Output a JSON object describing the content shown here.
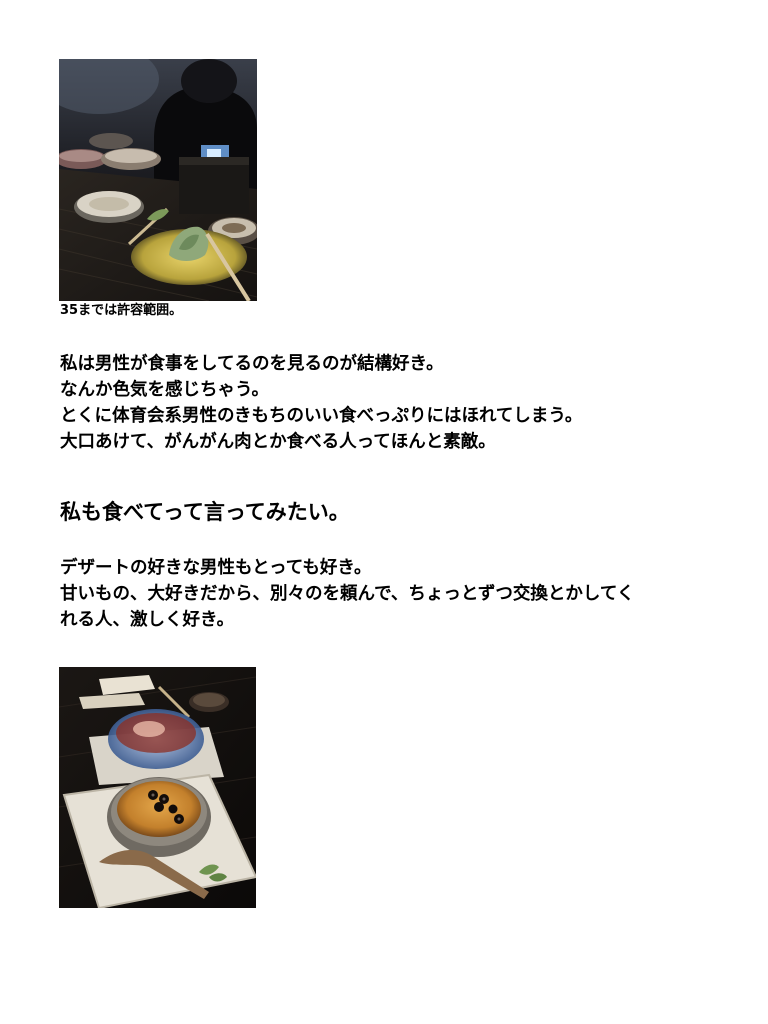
{
  "post": {
    "photo1": {
      "alt_icon": "food-photo-icon"
    },
    "caption": "35までは許容範囲。",
    "paragraph1": [
      "私は男性が食事をしてるのを見るのが結構好き。",
      "なんか色気を感じちゃう。",
      "とくに体育会系男性のきもちのいい食べっぷりにはほれてしまう。",
      "大口あけて、がんがん肉とか食べる人ってほんと素敵。"
    ],
    "headline": "私も食べてって言ってみたい。",
    "paragraph2": [
      "デザートの好きな男性もとっても好き。",
      "甘いもの、大好きだから、別々のを頼んで、ちょっとずつ交換とかしてく",
      "れる人、激しく好き。"
    ],
    "photo2": {
      "alt_icon": "dessert-photo-icon"
    }
  }
}
